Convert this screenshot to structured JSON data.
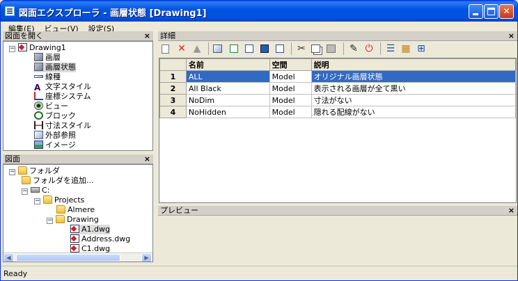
{
  "window": {
    "title": "図面エクスプローラ - 画層状態 [Drawing1]",
    "controls": {
      "minimize": "",
      "maximize": "",
      "close": "✕"
    }
  },
  "menu": [
    "編集(E)",
    "ビュー(V)",
    "設定(S)"
  ],
  "open_drawings_panel": {
    "title": "図面を開く",
    "close": "×",
    "root": "Drawing1",
    "items": [
      "画層",
      "画層状態",
      "線種",
      "文字スタイル",
      "座標システム",
      "ビュー",
      "ブロック",
      "寸法スタイル",
      "外部参照",
      "イメージ"
    ]
  },
  "drawings_panel": {
    "title": "図面",
    "close": "×",
    "tree": [
      {
        "label": "フォルダ"
      },
      {
        "label": "フォルダを追加..."
      },
      {
        "label": "C:"
      },
      {
        "label": "Projects"
      },
      {
        "label": "Almere"
      },
      {
        "label": "Drawing"
      },
      {
        "label": "A1.dwg"
      },
      {
        "label": "Address.dwg"
      },
      {
        "label": "C1.dwg"
      }
    ]
  },
  "details_panel": {
    "title": "詳細",
    "close": "×",
    "columns": [
      "名前",
      "空間",
      "説明"
    ],
    "rows": [
      {
        "num": "1",
        "name": "ALL",
        "space": "Model",
        "desc": "オリジナル画層状態"
      },
      {
        "num": "2",
        "name": "All Black",
        "space": "Model",
        "desc": "表示される画層が全て黒い"
      },
      {
        "num": "3",
        "name": "NoDim",
        "space": "Model",
        "desc": "寸法がない"
      },
      {
        "num": "4",
        "name": "NoHidden",
        "space": "Model",
        "desc": "隠れる配線がない"
      }
    ]
  },
  "preview_panel": {
    "title": "プレビュー",
    "close": "×"
  },
  "status": "Ready",
  "colors": {
    "selection": "#316ac5",
    "titlebar": "#0054e3",
    "face": "#ece9d8"
  }
}
